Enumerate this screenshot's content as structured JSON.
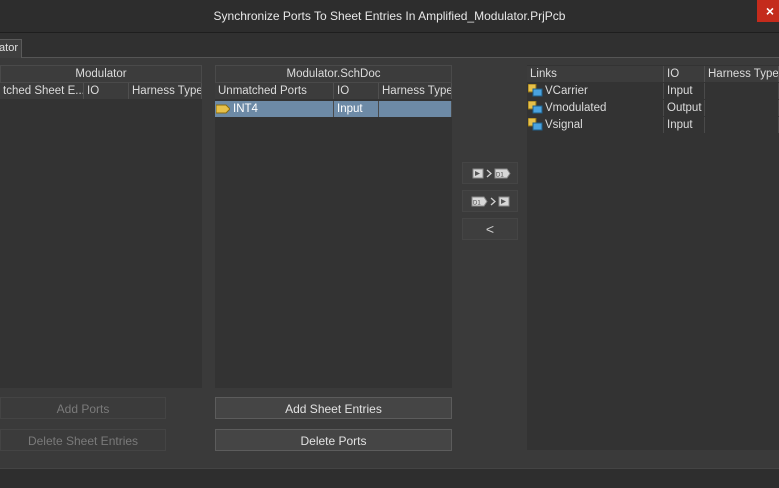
{
  "window": {
    "title": "Synchronize Ports To Sheet Entries In Amplified_Modulator.PrjPcb",
    "close_glyph": "×",
    "tab_label": "ator"
  },
  "left_panel": {
    "header": "Modulator",
    "columns": [
      "tched Sheet E...",
      "IO",
      "Harness Type"
    ],
    "rows": []
  },
  "middle_panel": {
    "header": "Modulator.SchDoc",
    "columns": [
      "Unmatched Ports",
      "IO",
      "Harness Type"
    ],
    "rows": [
      {
        "name": "INT4",
        "io": "Input",
        "harness": "",
        "selected": true
      }
    ]
  },
  "right_panel": {
    "columns": [
      "Links",
      "IO",
      "Harness Type"
    ],
    "rows": [
      {
        "name": "VCarrier",
        "io": "Input",
        "harness": ""
      },
      {
        "name": "Vmodulated",
        "io": "Output",
        "harness": ""
      },
      {
        "name": "Vsignal",
        "io": "Input",
        "harness": ""
      }
    ]
  },
  "buttons": {
    "add_ports": "Add Ports",
    "delete_sheet_entries": "Delete Sheet Entries",
    "add_sheet_entries": "Add Sheet Entries",
    "delete_ports": "Delete Ports",
    "link_ports_to_entries": "port-to-entry-link-icon",
    "link_entries_to_ports": "entry-to-port-link-icon",
    "unlink": "<"
  },
  "colors": {
    "selection": "#6d8aa6",
    "accent_close": "#c42b1c"
  }
}
